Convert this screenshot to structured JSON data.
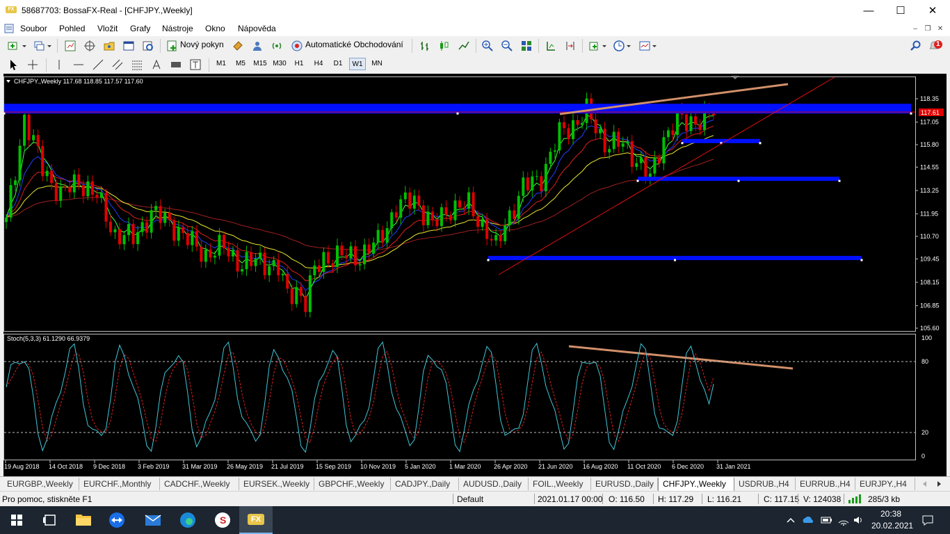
{
  "window": {
    "title": "58687703: BossaFX-Real - [CHFJPY.,Weekly]",
    "logo": "FX"
  },
  "menu": {
    "items": [
      "Soubor",
      "Pohled",
      "Vložit",
      "Grafy",
      "Nástroje",
      "Okno",
      "Nápověda"
    ]
  },
  "toolbar": {
    "new_order_label": "Nový pokyn",
    "auto_trading_label": "Automatické Obchodování",
    "notification_count": "1"
  },
  "timeframes": [
    "M1",
    "M5",
    "M15",
    "M30",
    "H1",
    "H4",
    "D1",
    "W1",
    "MN"
  ],
  "timeframe_selected": "W1",
  "chart": {
    "symbol_header": "CHFJPY.,Weekly  117.68 118.85 117.57 117.60",
    "current_price_label": "117.61",
    "price_ticks": [
      "118.35",
      "117.05",
      "115.80",
      "114.55",
      "113.25",
      "111.95",
      "110.70",
      "109.45",
      "108.15",
      "106.85",
      "105.60"
    ],
    "date_ticks": [
      "19 Aug 2018",
      "14 Oct 2018",
      "9 Dec 2018",
      "3 Feb 2019",
      "31 Mar 2019",
      "26 May 2019",
      "21 Jul 2019",
      "15 Sep 2019",
      "10 Nov 2019",
      "5 Jan 2020",
      "1 Mar 2020",
      "26 Apr 2020",
      "21 Jun 2020",
      "16 Aug 2020",
      "11 Oct 2020",
      "6 Dec 2020",
      "31 Jan 2021"
    ],
    "stoch_header": "Stoch(5,3,3) 61.1290 66.9379",
    "stoch_ticks": [
      "100",
      "80",
      "20",
      "0"
    ],
    "colors": {
      "bull": "#00c000",
      "bear": "#e00000",
      "zone": "#0010ff",
      "trendline": "#e01010",
      "resistance": "#d2906a",
      "ma_fast": "#40ff40",
      "ma_mid": "#2040ff",
      "ma_red": "#e02020",
      "ma_yellow": "#e8e830",
      "ma_slow": "#a02020",
      "stoch_main": "#40c8d8",
      "stoch_signal": "#e02020"
    }
  },
  "chart_data": {
    "type": "candlestick",
    "symbol": "CHFJPY.",
    "timeframe": "Weekly",
    "last_bar": {
      "open": 117.68,
      "high": 118.85,
      "low": 117.57,
      "close": 117.6
    },
    "x_range": [
      "19 Aug 2018",
      "31 Jan 2021"
    ],
    "ylim": [
      105.6,
      118.35
    ],
    "horizontal_zones": [
      117.8,
      116.0,
      113.9,
      109.5
    ],
    "stochastic": {
      "params": "5,3,3",
      "main": 61.129,
      "signal": 66.9379,
      "levels": [
        80,
        20
      ],
      "ylim": [
        0,
        100
      ]
    }
  },
  "tabs": [
    "EURGBP.,Weekly",
    "EURCHF.,Monthly",
    "CADCHF.,Weekly",
    "EURSEK.,Weekly",
    "GBPCHF.,Weekly",
    "CADJPY.,Daily",
    "AUDUSD.,Daily",
    "FOIL.,Weekly",
    "EURUSD.,Daily",
    "CHFJPY.,Weekly",
    "USDRUB.,H4",
    "EURRUB.,H4",
    "EURJPY.,H4"
  ],
  "active_tab": "CHFJPY.,Weekly",
  "status": {
    "help": "Pro pomoc, stiskněte F1",
    "profile": "Default",
    "datetime": "2021.01.17 00:00",
    "open": "O: 116.50",
    "high": "H: 117.29",
    "low": "L: 116.21",
    "close": "C: 117.15",
    "volume": "V: 124038",
    "traffic": "285/3 kb"
  },
  "taskbar": {
    "time": "20:38",
    "date": "20.02.2021",
    "fx_label": "FX"
  }
}
